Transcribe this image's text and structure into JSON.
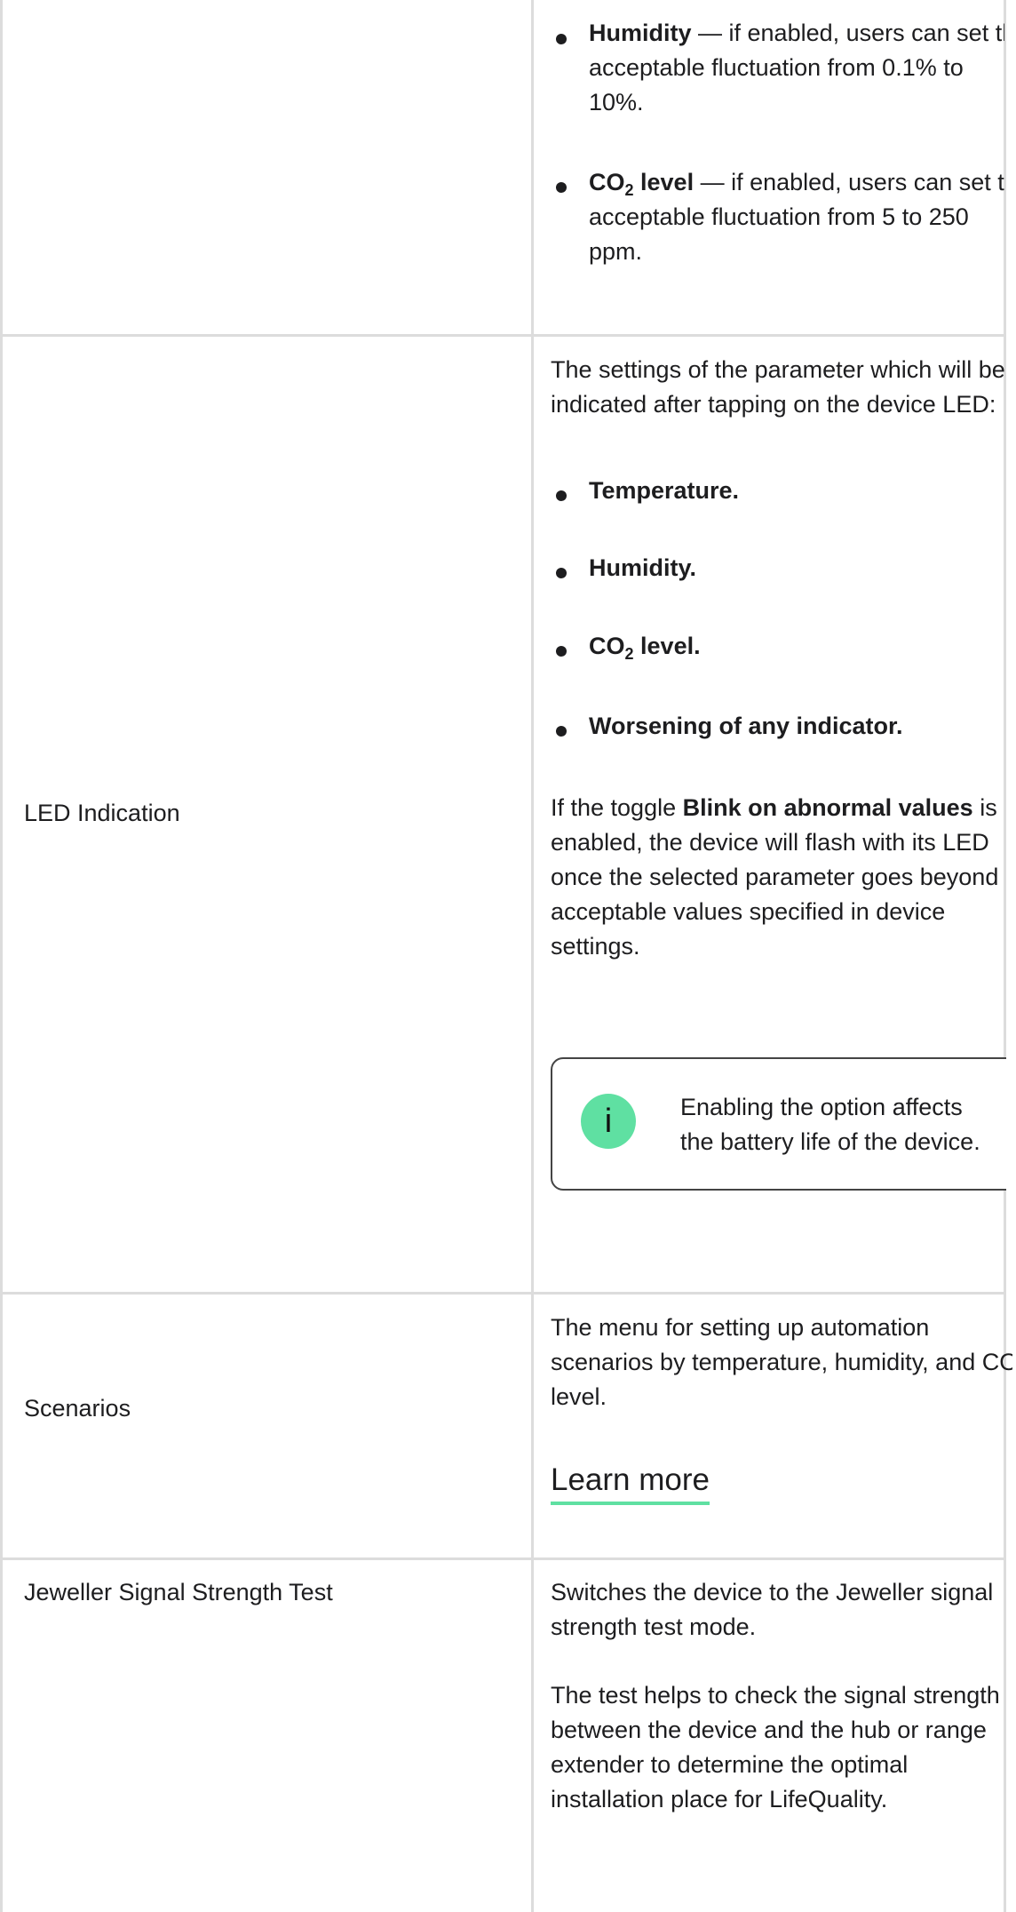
{
  "rows": {
    "continued": {
      "bullets": [
        {
          "bold": "Humidity",
          "rest": " — if enabled, users can set the",
          "lines": [
            "acceptable fluctuation from 0.1% to",
            "10%."
          ]
        },
        {
          "bold_main": "CO",
          "bold_sub": "2",
          "bold_after": " level",
          "rest": " — if enabled, users can set the",
          "lines": [
            "acceptable fluctuation from 5 to 250",
            "ppm."
          ]
        }
      ]
    },
    "led": {
      "label": "LED Indication",
      "intro": [
        "The settings of the parameter which will be",
        "indicated after tapping on the device LED:"
      ],
      "options": [
        "Temperature.",
        "Humidity.",
        "level.",
        "Worsening of any indicator."
      ],
      "co2_main": "CO",
      "co2_sub": "2",
      "blink_prefix": "If the toggle ",
      "blink_bold": "Blink on abnormal values",
      "blink_suffix": " is",
      "blink_lines": [
        "enabled, the device will flash with its LED",
        "once the selected parameter goes beyond",
        "acceptable values specified in device",
        "settings."
      ],
      "note_icon": "info-icon",
      "note_lines": [
        "Enabling the option affects",
        "the battery life of the device."
      ]
    },
    "scenarios": {
      "label": "Scenarios",
      "desc": [
        "The menu for setting up automation",
        "scenarios by temperature, humidity, and CO",
        "level."
      ],
      "link": "Learn more"
    },
    "jeweller": {
      "label": "Jeweller Signal Strength Test",
      "p1": [
        "Switches the device to the Jeweller signal",
        "strength test mode."
      ],
      "p2": [
        "The test helps to check the signal strength",
        "between the device and the hub or range",
        "extender to determine the optimal",
        "installation place for LifeQuality."
      ]
    }
  },
  "colors": {
    "accent": "#5fe0a2",
    "border": "#dcdcdc",
    "text": "#1d1d1f"
  }
}
